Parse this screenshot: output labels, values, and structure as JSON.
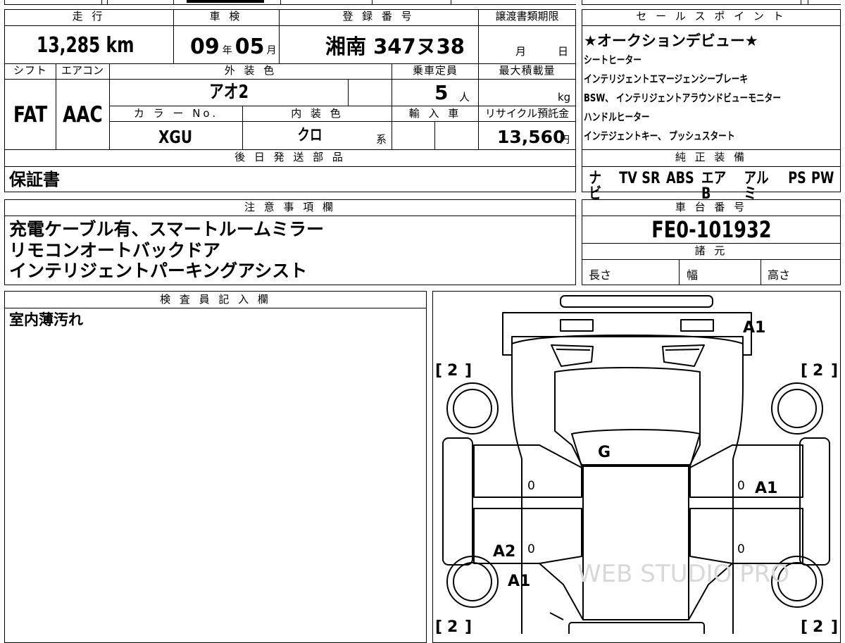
{
  "top_table": {
    "mileage": {
      "label": "走 行",
      "value": "13,285",
      "unit": "km"
    },
    "shaken": {
      "label": "車 検",
      "year": "09",
      "year_unit": "年",
      "month": "05",
      "month_unit": "月"
    },
    "registration": {
      "label": "登 録 番 号",
      "value": "湘南 347ヌ38"
    },
    "transfer_deadline": {
      "label": "譲渡書類期限",
      "month_unit": "月",
      "day_unit": "日"
    },
    "shift": {
      "label": "シフト",
      "value": "FAT"
    },
    "aircon": {
      "label": "エアコン",
      "value": "AAC"
    },
    "exterior_color": {
      "label": "外 装 色",
      "value": "アオ2"
    },
    "capacity": {
      "label": "乗車定員",
      "value": "5",
      "unit": "人"
    },
    "max_load": {
      "label": "最大積載量",
      "unit": "kg"
    },
    "color_no": {
      "label": "カ ラ ー No.",
      "value": "XGU"
    },
    "interior_color": {
      "label": "内 装 色",
      "value": "クロ",
      "suffix": "系"
    },
    "import": {
      "label": "輸 入 車"
    },
    "recycle": {
      "label": "リサイクル預託金",
      "value": "13,560",
      "unit": "円"
    },
    "later_parts": {
      "label": "後 日 発 送 部 品",
      "value": "保証書"
    }
  },
  "sales_points": {
    "label": "セ ー ル ス ポ イ ン ト",
    "lines": [
      "★オークションデビュー★",
      "シートヒーター",
      "インテリジェントエマージェンシーブレーキ",
      "BSW、 インテリジェントアラウンドビューモニター",
      "ハンドルヒーター",
      "インテジェントキー、 プッシュスタート"
    ]
  },
  "genuine_equipment": {
    "label": "純 正 装 備",
    "items": [
      "ナビ",
      "TV",
      "SR",
      "ABS",
      "エアB",
      "アルミ",
      "PS",
      "PW"
    ]
  },
  "notes": {
    "label": "注 意 事 項 欄",
    "lines": [
      "充電ケーブル有、スマートルームミラー",
      "リモコンオートバックドア",
      "インテリジェントパーキングアシスト"
    ]
  },
  "chassis": {
    "label": "車 台 番 号",
    "value": "FE0-101932"
  },
  "specs": {
    "label": "諸 元",
    "length": "長さ",
    "width": "幅",
    "height": "高さ"
  },
  "inspector": {
    "label": "検 査 員 記 入 欄",
    "value": "室内薄汚れ"
  },
  "diagram": {
    "marks": {
      "front_bumper": "A1",
      "hood": "G",
      "right_front_door": "A1",
      "left_rear_door": "A2",
      "left_rear_fender": "A1"
    },
    "tire_marks": "2",
    "door_zeros": "0"
  },
  "watermark": "WEB STUDIO PRO"
}
